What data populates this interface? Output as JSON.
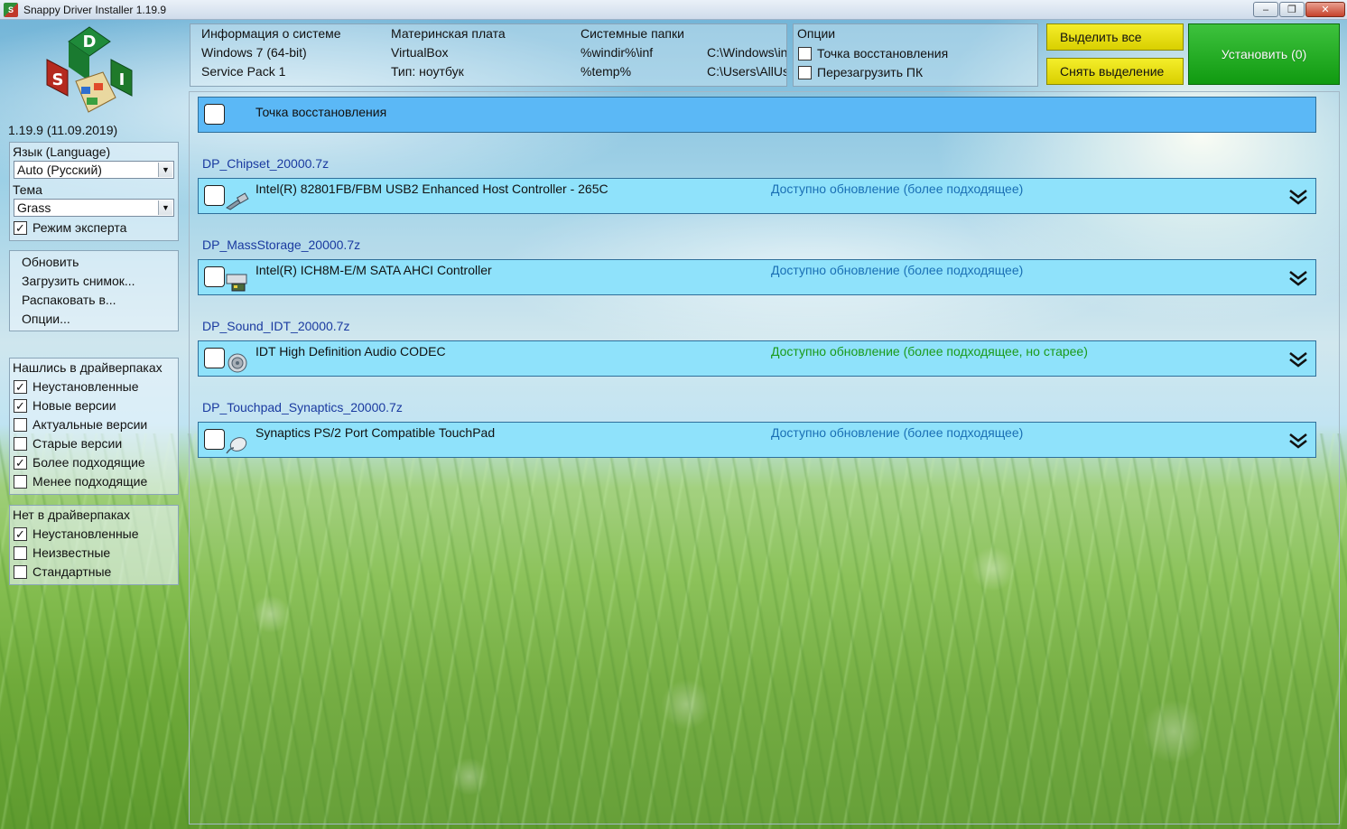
{
  "window": {
    "title": "Snappy Driver Installer 1.19.9",
    "app_icon": "sdi-icon",
    "minimize_label": "–",
    "maximize_label": "❐",
    "close_label": "✕"
  },
  "logo": {
    "letters": [
      "D",
      "S",
      "I"
    ]
  },
  "version": "1.19.9 (11.09.2019)",
  "settings": {
    "language_label": "Язык (Language)",
    "language_value": "Auto (Русский)",
    "theme_label": "Тема",
    "theme_value": "Grass",
    "expert_label": "Режим эксперта",
    "expert_checked": true
  },
  "menu": {
    "items": [
      "Обновить",
      "Загрузить снимок...",
      "Распаковать в...",
      "Опции..."
    ]
  },
  "found_filters": {
    "title": "Нашлись в драйверпаках",
    "items": [
      {
        "label": "Неустановленные",
        "checked": true
      },
      {
        "label": "Новые версии",
        "checked": true
      },
      {
        "label": "Актуальные версии",
        "checked": false
      },
      {
        "label": "Старые версии",
        "checked": false
      },
      {
        "label": "Более подходящие",
        "checked": true
      },
      {
        "label": "Менее подходящие",
        "checked": false
      }
    ]
  },
  "missing_filters": {
    "title": "Нет в драйверпаках",
    "items": [
      {
        "label": "Неустановленные",
        "checked": true
      },
      {
        "label": "Неизвестные",
        "checked": false
      },
      {
        "label": "Стандартные",
        "checked": false
      }
    ]
  },
  "sysinfo": {
    "col1": [
      "Информация о системе",
      "Windows 7 (64-bit)",
      "Service Pack 1"
    ],
    "col2": [
      "Материнская плата",
      "VirtualBox",
      "Тип: ноутбук"
    ],
    "col3": [
      "Системные папки",
      "%windir%\\inf",
      "%temp%"
    ],
    "col4": [
      "",
      "C:\\Windows\\inf",
      "C:\\Users\\AllUs"
    ]
  },
  "options": {
    "title": "Опции",
    "restore_point": "Точка восстановления",
    "reboot": "Перезагрузить ПК"
  },
  "buttons": {
    "select_all": "Выделить все",
    "deselect": "Снять выделение",
    "install": "Установить (0)"
  },
  "colors": {
    "install": "#1aa81a",
    "yellow_button": "#e8e010",
    "restore_row": "#5bb8f6",
    "driver_row": "#8fe2fb",
    "pack_title": "#1a3aa0",
    "status_blue": "#1a6fb4",
    "status_green": "#1a9a1a"
  },
  "restore_row": {
    "label": "Точка восстановления"
  },
  "packs": [
    {
      "title": "DP_Chipset_20000.7z",
      "device": "Intel(R) 82801FB/FBM USB2 Enhanced Host Controller - 265C",
      "status": "Доступно обновление (более подходящее)",
      "icon": "usb-plug-icon"
    },
    {
      "title": "DP_MassStorage_20000.7z",
      "device": "Intel(R) ICH8M-E/M SATA AHCI Controller",
      "status": "Доступно обновление (более подходящее)",
      "icon": "storage-controller-icon"
    },
    {
      "title": "DP_Sound_IDT_20000.7z",
      "device": "IDT High Definition Audio CODEC",
      "status": "Доступно обновление (более подходящее, но старее)",
      "icon": "speaker-icon"
    },
    {
      "title": "DP_Touchpad_Synaptics_20000.7z",
      "device": "Synaptics PS/2 Port Compatible TouchPad",
      "status": "Доступно обновление (более подходящее)",
      "icon": "mouse-icon"
    }
  ]
}
